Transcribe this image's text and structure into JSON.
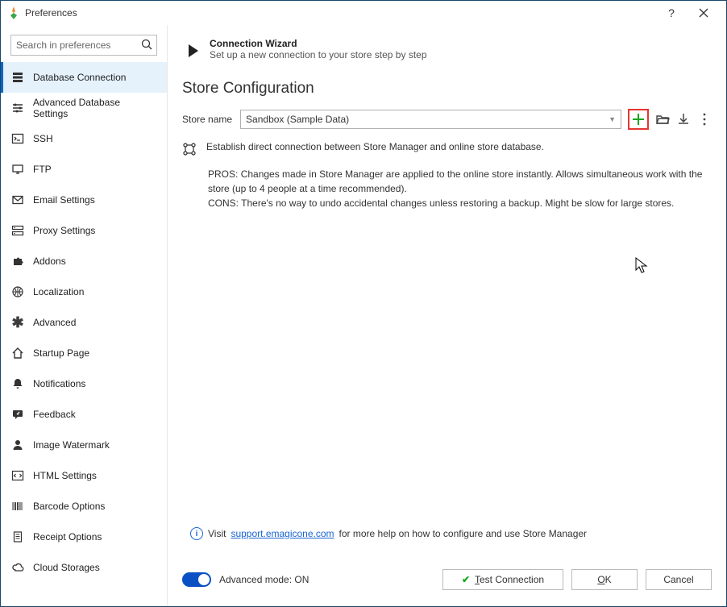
{
  "window": {
    "title": "Preferences",
    "help_tooltip": "?",
    "close_tooltip": "Close"
  },
  "sidebar": {
    "search_placeholder": "Search in preferences",
    "items": [
      {
        "label": "Database Connection"
      },
      {
        "label": "Advanced Database Settings"
      },
      {
        "label": "SSH"
      },
      {
        "label": "FTP"
      },
      {
        "label": "Email Settings"
      },
      {
        "label": "Proxy Settings"
      },
      {
        "label": "Addons"
      },
      {
        "label": "Localization"
      },
      {
        "label": "Advanced"
      },
      {
        "label": "Startup Page"
      },
      {
        "label": "Notifications"
      },
      {
        "label": "Feedback"
      },
      {
        "label": "Image Watermark"
      },
      {
        "label": "HTML Settings"
      },
      {
        "label": "Barcode Options"
      },
      {
        "label": "Receipt Options"
      },
      {
        "label": "Cloud Storages"
      }
    ]
  },
  "wizard": {
    "title": "Connection Wizard",
    "subtitle": "Set up a new connection to your store step by step"
  },
  "section": {
    "title": "Store Configuration",
    "store_name_label": "Store name",
    "store_name_value": "Sandbox (Sample Data)"
  },
  "connection": {
    "summary": "Establish direct connection between Store Manager and online store database.",
    "pros_label": "PROS:",
    "pros_text": "Changes made in Store Manager are applied to the online store instantly. Allows simultaneous work with the store (up to 4 people at a time recommended).",
    "cons_label": "CONS:",
    "cons_text": "There's no way to undo accidental changes unless restoring a backup. Might be slow for large stores."
  },
  "support": {
    "prefix": "Visit ",
    "link_text": "support.emagicone.com",
    "suffix": " for more help on how to configure and use Store Manager"
  },
  "footer": {
    "advanced_mode_label": "Advanced mode: ON",
    "test_connection": "Test Connection",
    "ok": "OK",
    "cancel": "Cancel"
  }
}
